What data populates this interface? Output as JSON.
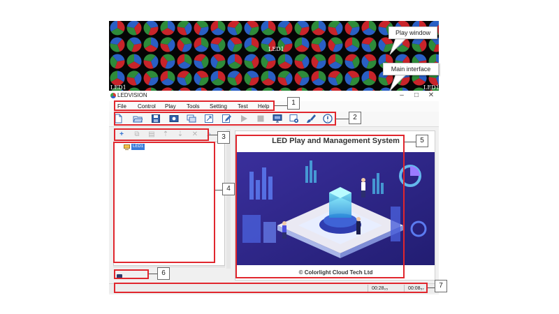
{
  "play_window": {
    "callout": "Play window",
    "center_label": "LED1",
    "corner_left_label": "LED1",
    "corner_right_label": "LED1"
  },
  "main_window": {
    "callout": "Main interface",
    "title": "LEDVISION",
    "controls": [
      "–",
      "□",
      "✕"
    ]
  },
  "menu": {
    "items": [
      "File",
      "Control",
      "Play",
      "Tools",
      "Setting",
      "Test",
      "Help"
    ]
  },
  "toolbar": {
    "icons": [
      "new-file-icon",
      "open-folder-icon",
      "save-icon",
      "screen-icon",
      "display-window-icon",
      "fullscreen-icon",
      "edit-icon",
      "play-icon",
      "stop-icon",
      "monitor-icon",
      "settings-icon",
      "brush-icon",
      "info-icon"
    ]
  },
  "side_tools": {
    "icons": [
      "add-icon",
      "copy-icon",
      "paste-icon",
      "move-up-icon",
      "move-down-icon",
      "delete-icon",
      "search-icon"
    ],
    "glyphs": [
      "+",
      "⧉",
      "▤",
      "⇡",
      "⇣",
      "✕",
      "⌕"
    ]
  },
  "tree": {
    "node_label": "LED1"
  },
  "preview": {
    "title": "LED Play and Management System",
    "copyright": "© Colorlight Cloud Tech Ltd"
  },
  "status": {
    "time_elapsed": "00:28₀₅",
    "time_total": "00:08₅₇"
  },
  "annotations": [
    "1",
    "2",
    "3",
    "4",
    "5",
    "6",
    "7"
  ],
  "colors": {
    "highlight": "#e0262d",
    "led_red": "#c8242a",
    "led_green": "#2e8b3a",
    "led_blue": "#2a5fc4",
    "preview_bg": "#2e2a8c"
  }
}
